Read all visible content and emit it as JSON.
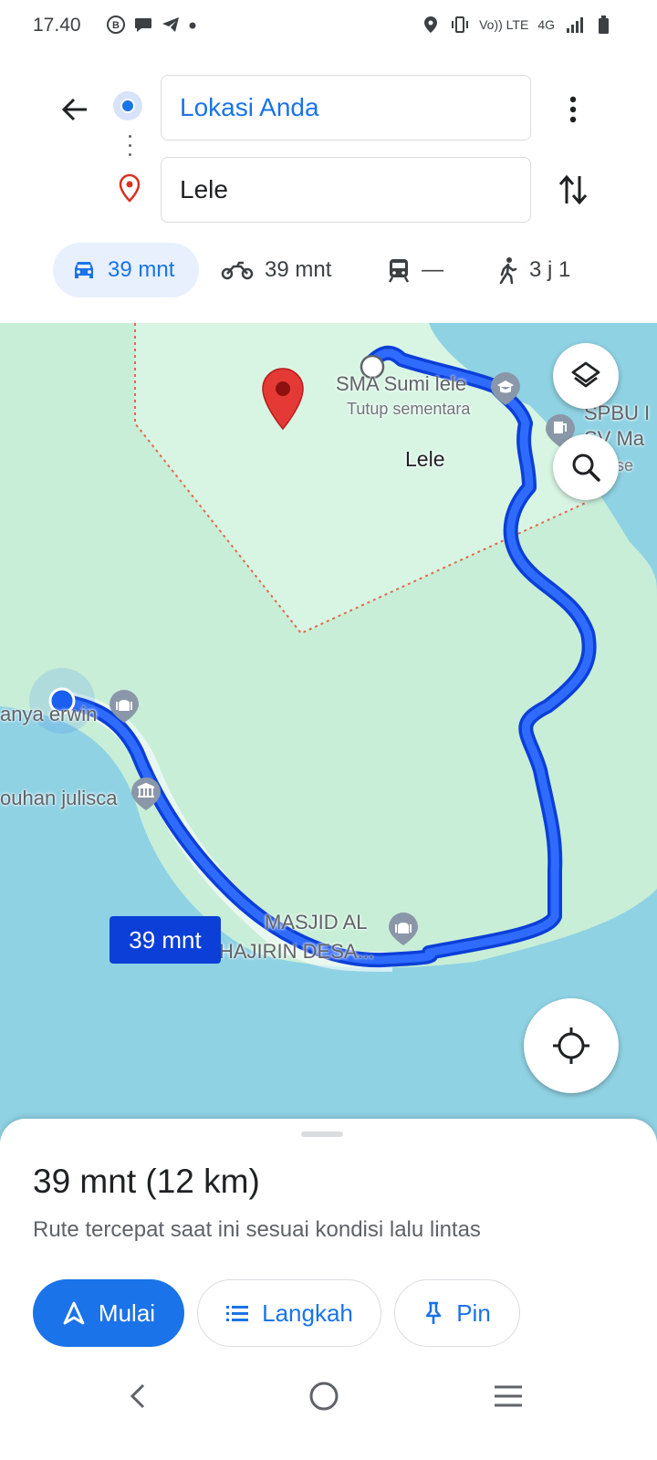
{
  "status_bar": {
    "time": "17.40",
    "network": "4G",
    "left_icons": [
      "b-icon",
      "chat-bubble-icon",
      "telegram-icon",
      "dot-icon"
    ],
    "right_icons": [
      "location-icon",
      "vibrate-icon",
      "volte-icon",
      "signal-icon",
      "battery-icon"
    ],
    "volte_label": "Vo)) LTE"
  },
  "directions": {
    "origin_value": "Lokasi Anda",
    "destination_value": "Lele"
  },
  "travel_modes": [
    {
      "mode": "car",
      "label": "39 mnt",
      "selected": true
    },
    {
      "mode": "motorcycle",
      "label": "39 mnt"
    },
    {
      "mode": "transit",
      "label": "—"
    },
    {
      "mode": "walk",
      "label": "3 j 1"
    }
  ],
  "map": {
    "labels": {
      "school": "SMA Sumi lele",
      "school_status": "Tutup sementara",
      "spbu": "SPBU I",
      "spbu_2": "SV Ma",
      "spbu_3": "p se",
      "area": "Lele",
      "place_1": "anya erwin",
      "place_2": "ouhan julisca",
      "mosque_line1": "MASJID AL",
      "mosque_line2": "HAJIRIN DESA..."
    },
    "route_time_badge": "39 mnt",
    "route_color": "#1a4fe8",
    "land_color": "#d3f2df",
    "water_color": "#8fd2e3"
  },
  "sheet": {
    "summary": "39 mnt (12 km)",
    "description": "Rute tercepat saat ini sesuai kondisi lalu lintas",
    "start_label": "Mulai",
    "steps_label": "Langkah",
    "pin_label": "Pin"
  },
  "accent_color": "#1a73e8"
}
